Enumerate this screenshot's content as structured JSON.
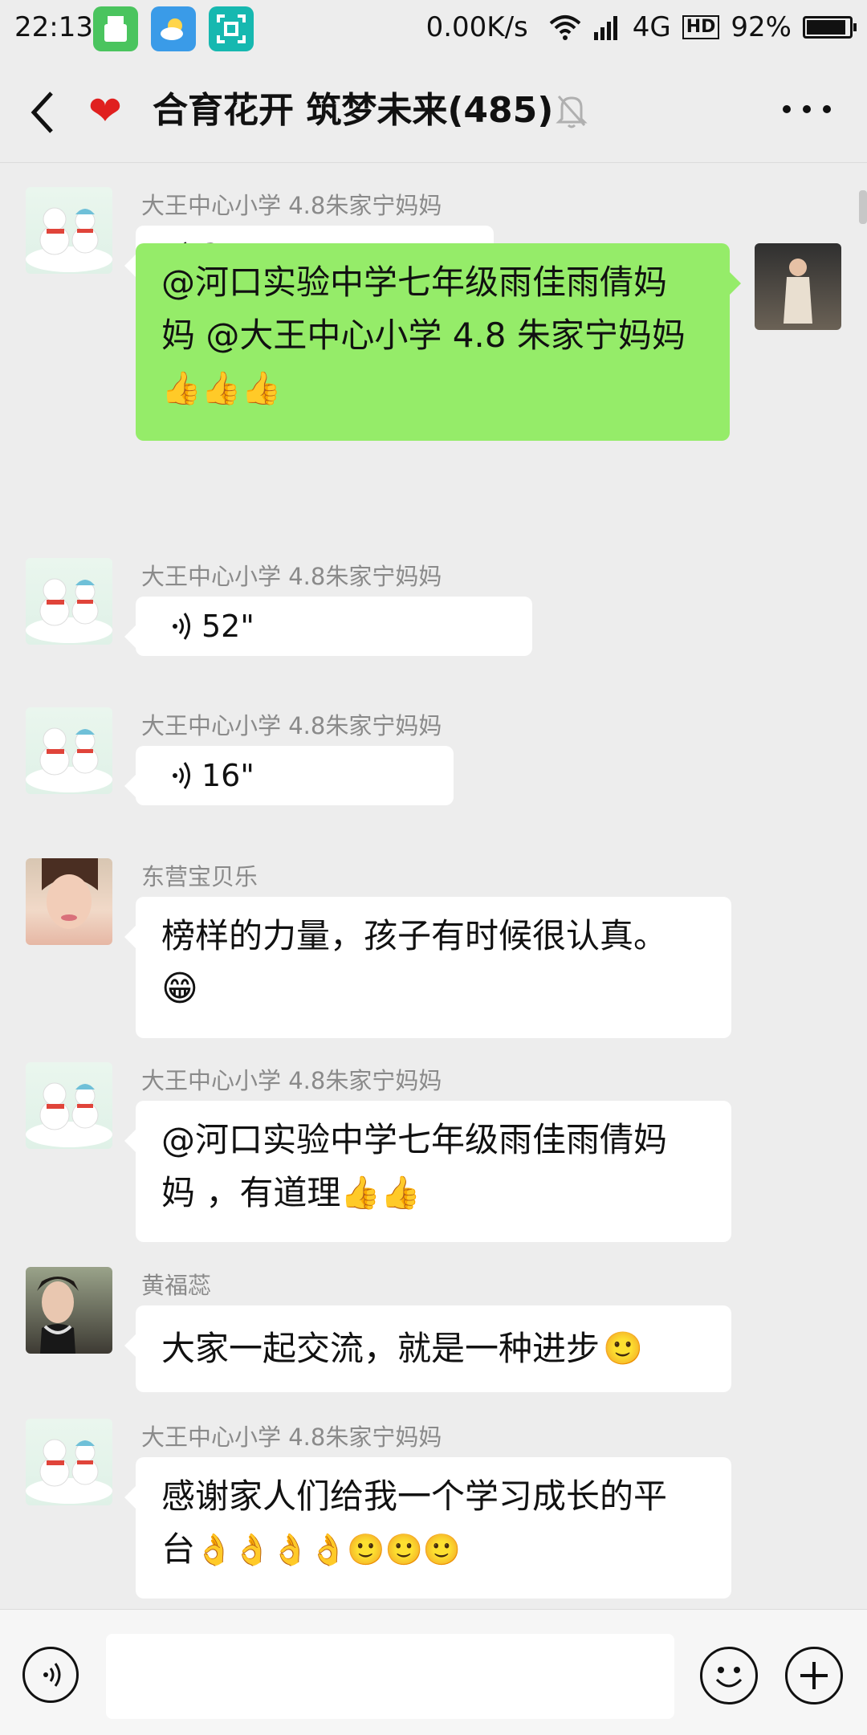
{
  "status_bar": {
    "time": "22:13",
    "net_speed": "0.00K/s",
    "network": "4G",
    "hd": "HD",
    "battery_text": "92%",
    "battery_level": 0.92
  },
  "header": {
    "title": "合育花开 筑梦未来(485)",
    "title_icon": "red-heart"
  },
  "messages": [
    {
      "side": "left",
      "sender": "大王中心小学 4.8朱家宁妈妈",
      "type": "voice",
      "duration": "35\"",
      "avatar": "snowman"
    },
    {
      "side": "right",
      "type": "text",
      "text_line1": "@河口实验中学七年级雨佳雨倩妈",
      "text_line2": "妈 @大王中心小学 4.8 朱家宁妈妈",
      "emoji": "👍👍👍",
      "avatar": "self"
    },
    {
      "side": "left",
      "sender": "大王中心小学 4.8朱家宁妈妈",
      "type": "voice",
      "duration": "52\"",
      "avatar": "snowman"
    },
    {
      "side": "left",
      "sender": "大王中心小学 4.8朱家宁妈妈",
      "type": "voice",
      "duration": "16\"",
      "avatar": "snowman"
    },
    {
      "side": "left",
      "sender": "东营宝贝乐",
      "type": "text",
      "text_line1": "榜样的力量，孩子有时候很认真。",
      "emoji": "😁",
      "avatar": "woman"
    },
    {
      "side": "left",
      "sender": "大王中心小学 4.8朱家宁妈妈",
      "type": "text",
      "text_line1": "@河口实验中学七年级雨佳雨倩妈",
      "text_line2": "妈 ，有道理",
      "emoji": "👍👍",
      "avatar": "snowman"
    },
    {
      "side": "left",
      "sender": "黄福蕊",
      "type": "text",
      "text_line1": "大家一起交流，就是一种进步",
      "emoji": "🙂",
      "avatar": "woman2"
    },
    {
      "side": "left",
      "sender": "大王中心小学 4.8朱家宁妈妈",
      "type": "text",
      "text_line1": "感谢家人们给我一个学习成长的平",
      "text_line2": "台",
      "emoji": "👌👌👌👌🙂🙂🙂",
      "avatar": "snowman"
    }
  ],
  "input_bar": {
    "voice_icon": "voice-icon",
    "emoji_icon": "smiley-icon",
    "plus_icon": "plus-icon"
  },
  "colors": {
    "background": "#ededed",
    "own_bubble": "#95ec69",
    "other_bubble": "#ffffff",
    "name_gray": "#8a8a8a"
  }
}
